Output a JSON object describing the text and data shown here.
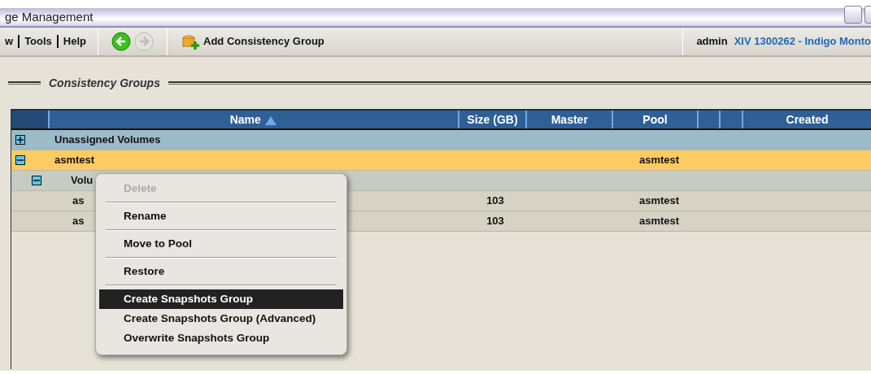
{
  "window": {
    "title": "ge Management"
  },
  "toolbar": {
    "menus": [
      "w",
      "Tools",
      "Help"
    ],
    "nav": [
      {
        "kind": "back",
        "disabled": false
      },
      {
        "kind": "forward",
        "disabled": true
      }
    ],
    "action": "Add Consistency Group",
    "user": "admin",
    "system": "XIV 1300262 - Indigo Monto"
  },
  "section_title": "Consistency Groups",
  "table": {
    "columns": [
      {
        "label": "Name",
        "sorted": true
      },
      {
        "label": "Size (GB)",
        "sorted": false
      },
      {
        "label": "Master",
        "sorted": false
      },
      {
        "label": "Pool",
        "sorted": false
      },
      {
        "sorted": false
      },
      {
        "sorted": false
      },
      {
        "label": "Created",
        "sorted": false
      }
    ],
    "rows": [
      {
        "name": "Unassigned Volumes",
        "expanded": false,
        "selected": false
      },
      {
        "name": "asmtest",
        "pool": "asmtest",
        "expanded": true,
        "selected": true,
        "children": [
          {
            "name": "Volu",
            "expanded": true,
            "selected": false,
            "children": [
              {
                "name": "as",
                "size": "103",
                "pool": "asmtest",
                "selected": false
              },
              {
                "name": "as",
                "size": "103",
                "pool": "asmtest",
                "selected": false
              }
            ]
          }
        ]
      }
    ]
  },
  "context_menu": [
    {
      "label": "Delete",
      "disabled": true,
      "selected": false,
      "separator": true
    },
    {
      "label": "Rename",
      "disabled": false,
      "selected": false,
      "separator": true
    },
    {
      "label": "Move to Pool",
      "disabled": false,
      "selected": false,
      "separator": true
    },
    {
      "label": "Restore",
      "disabled": false,
      "selected": false,
      "separator": true
    },
    {
      "label": "Create Snapshots Group",
      "disabled": false,
      "selected": true,
      "separator": false
    },
    {
      "label": "Create Snapshots Group (Advanced)",
      "disabled": false,
      "selected": false,
      "separator": false
    },
    {
      "label": "Overwrite Snapshots Group",
      "disabled": false,
      "selected": false,
      "separator": false
    }
  ]
}
